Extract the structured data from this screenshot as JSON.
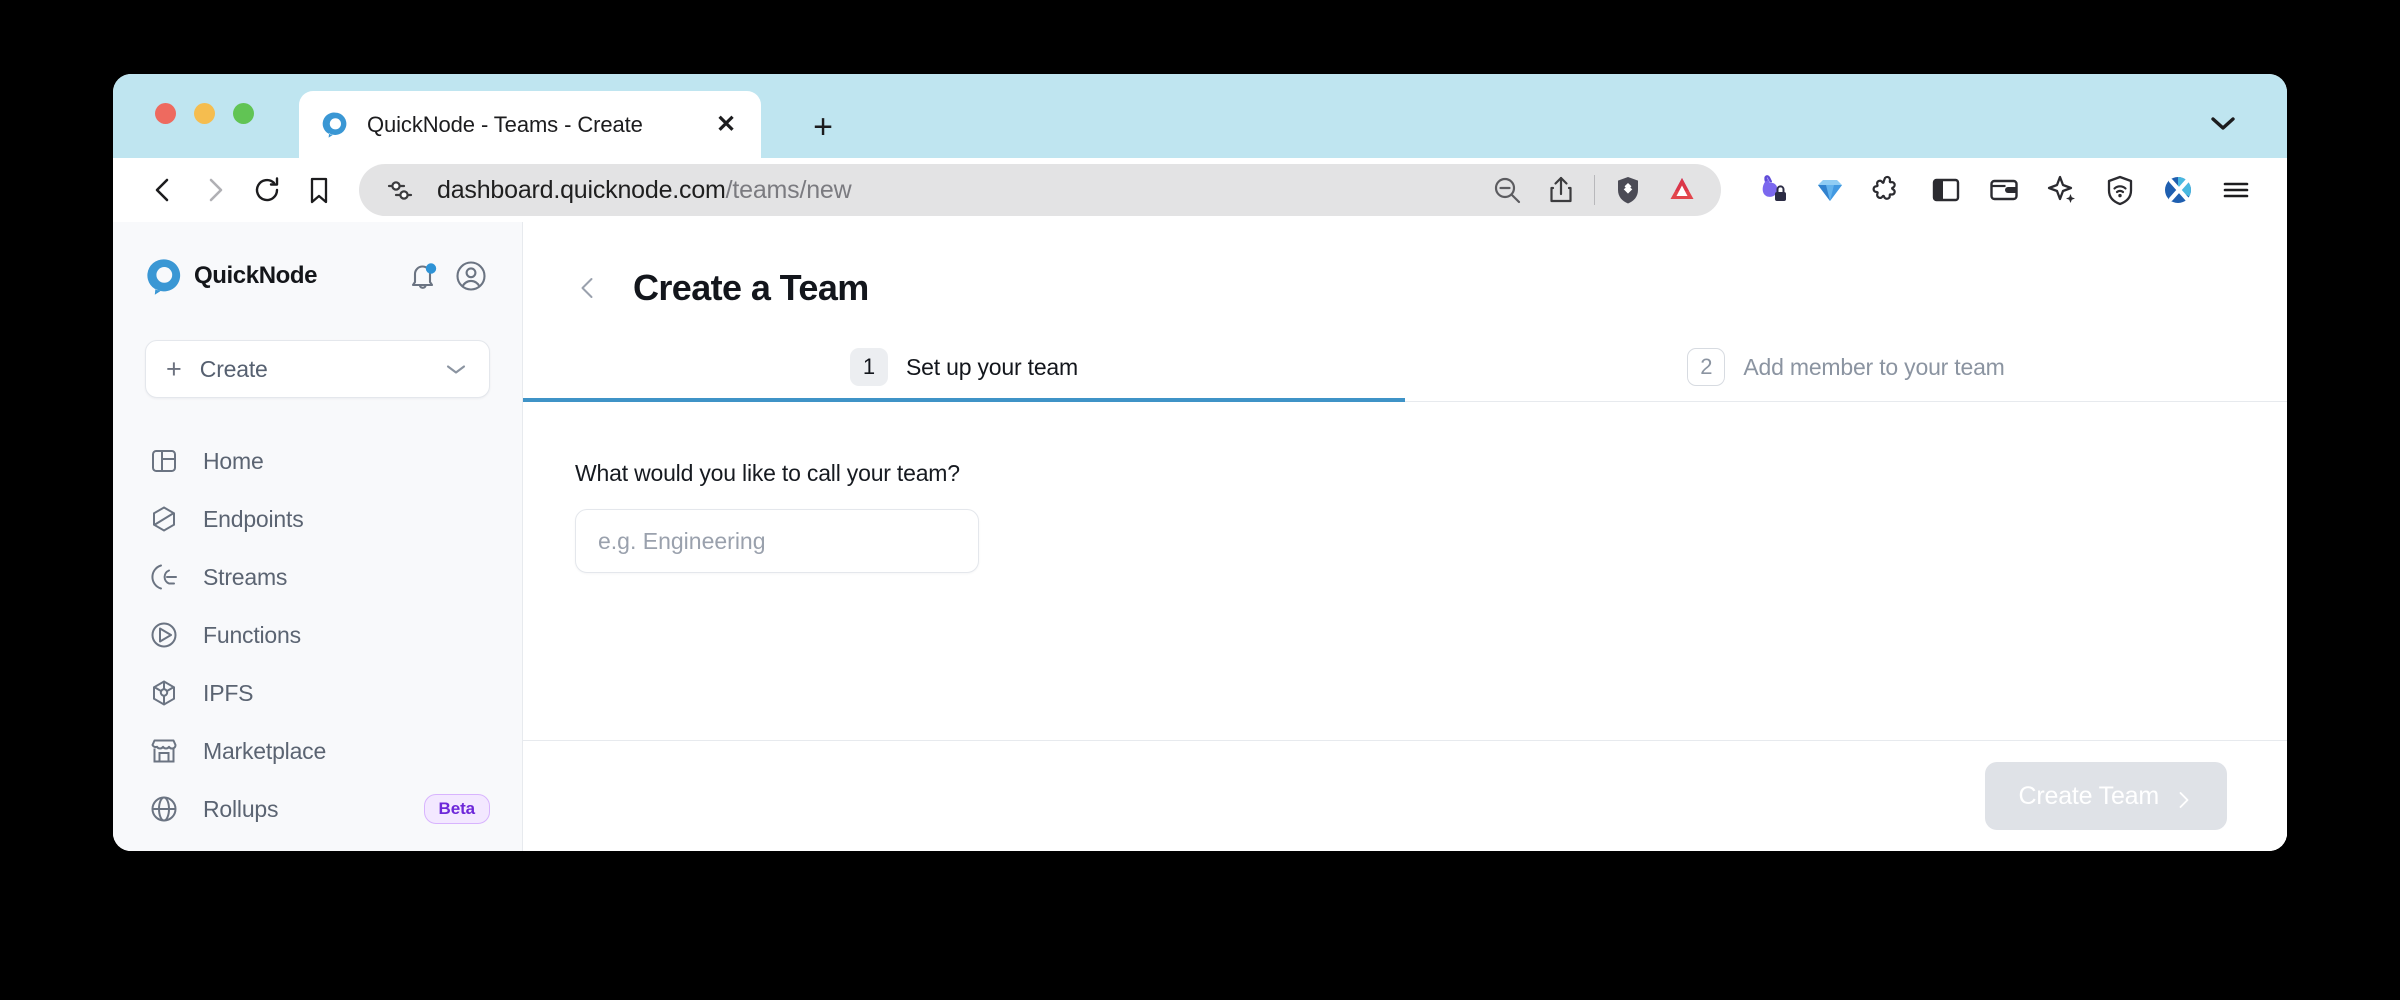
{
  "browser": {
    "traffic_lights": [
      "close",
      "minimize",
      "zoom"
    ],
    "tab": {
      "title": "QuickNode - Teams - Create",
      "favicon": "quicknode-q-icon",
      "close_label": "✕"
    },
    "new_tab_label": "+",
    "nav": {
      "back": "‹",
      "forward": "›",
      "reload": "reload-icon",
      "bookmark": "bookmark-icon"
    },
    "url": {
      "host": "dashboard.quicknode.com",
      "path": "/teams/new"
    },
    "urlbar_actions": [
      "zoom-out-icon",
      "share-icon",
      "brave-shields-icon",
      "bat-rewards-icon"
    ],
    "extensions": [
      "rabbit-lock-icon",
      "gem-icon",
      "puzzle-extensions-icon",
      "sidebar-panel-icon",
      "wallet-icon",
      "ai-sparkle-icon",
      "vpn-shield-icon",
      "x-logo-icon",
      "hamburger-menu-icon"
    ]
  },
  "sidebar": {
    "brand": "QuickNode",
    "notifications_badge": true,
    "create": {
      "label": "Create",
      "plus": "+"
    },
    "items": [
      {
        "label": "Home",
        "icon": "home-icon"
      },
      {
        "label": "Endpoints",
        "icon": "endpoints-icon"
      },
      {
        "label": "Streams",
        "icon": "streams-icon"
      },
      {
        "label": "Functions",
        "icon": "functions-icon"
      },
      {
        "label": "IPFS",
        "icon": "ipfs-icon"
      },
      {
        "label": "Marketplace",
        "icon": "marketplace-icon"
      },
      {
        "label": "Rollups",
        "icon": "rollups-globe-icon",
        "badge": "Beta"
      }
    ]
  },
  "main": {
    "title": "Create a Team",
    "back": "‹",
    "steps": [
      {
        "number": "1",
        "label": "Set up your team",
        "state": "active"
      },
      {
        "number": "2",
        "label": "Add member to your team",
        "state": "inactive"
      }
    ],
    "form": {
      "label": "What would you like to call your team?",
      "placeholder": "e.g. Engineering",
      "value": ""
    },
    "footer": {
      "submit_label": "Create Team",
      "submit_disabled": true
    }
  },
  "colors": {
    "tab_strip": "#bfe5f0",
    "accent_blue": "#3f93c7",
    "brand_blue": "#3a97d4",
    "beta_purple": "#6d28d9",
    "sidebar_bg": "#f8f9fb",
    "disabled_button": "#dfe2e7"
  }
}
